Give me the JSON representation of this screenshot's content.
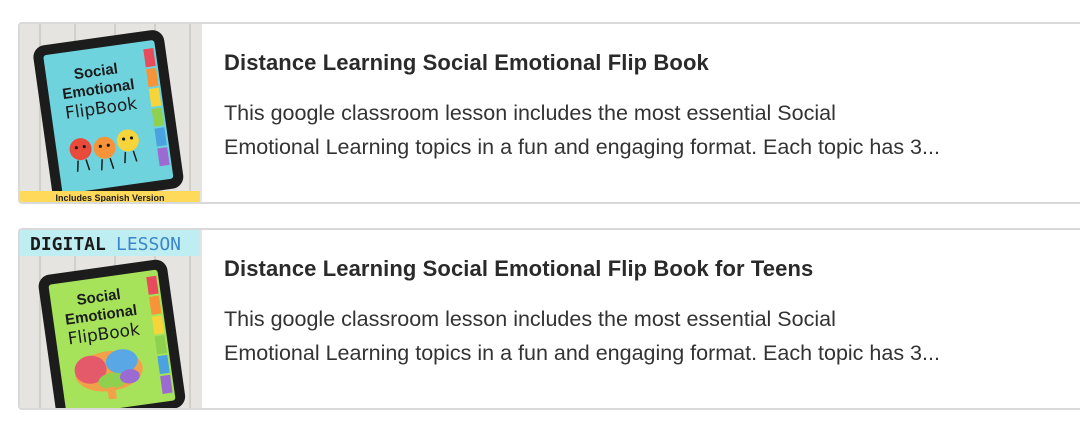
{
  "products": [
    {
      "title": "Distance Learning Social Emotional Flip Book",
      "desc_line1": "This google classroom lesson includes the most essential Social",
      "desc_line2": "Emotional Learning topics in a fun and engaging format. Each topic has 3...",
      "thumb": {
        "cover_l1": "Social",
        "cover_l2": "Emotional",
        "cover_l3": "FlipBook",
        "banner": "Includes Spanish Version",
        "screen_color": "#6fd3de",
        "banner_color": "#ffd95a"
      }
    },
    {
      "title": "Distance Learning Social Emotional Flip Book for Teens",
      "desc_line1": "This google classroom lesson includes the most essential Social",
      "desc_line2": "Emotional Learning topics in a fun and engaging format. Each topic has 3...",
      "thumb": {
        "badge_word1": "DIGITAL",
        "badge_word2": "LESSON",
        "cover_l1": "Social",
        "cover_l2": "Emotional",
        "cover_l3": "FlipBook",
        "screen_color": "#a6e35a",
        "badge_color": "#bfeef2"
      }
    }
  ]
}
